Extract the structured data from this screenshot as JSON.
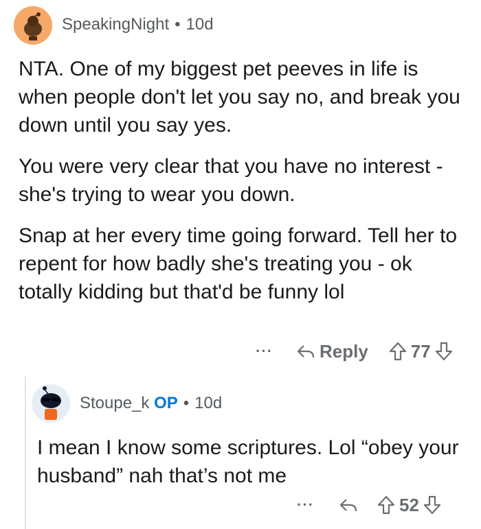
{
  "comments": [
    {
      "author": "SpeakingNight",
      "op_badge": "",
      "age": "10d",
      "paragraphs": [
        "NTA. One of my biggest pet peeves in life is when people don't let you say no, and break you down until you say yes.",
        "You were very clear that you have no interest - she's trying to wear you down.",
        "Snap at her every time going forward. Tell her to repent for how badly she's treating you - ok totally kidding but that'd be funny lol"
      ],
      "more_label": "···",
      "reply_label": "Reply",
      "vote_count": "77",
      "icons": {
        "reply": "reply-arrow-icon",
        "upvote": "upvote-arrow-icon",
        "downvote": "downvote-arrow-icon"
      }
    },
    {
      "author": "Stoupe_k",
      "op_badge": "OP",
      "age": "10d",
      "paragraphs": [
        "I mean I know some scriptures. Lol “obey your husband” nah that’s not me"
      ],
      "more_label": "···",
      "reply_label": "",
      "vote_count": "52",
      "icons": {
        "reply": "reply-arrow-icon",
        "upvote": "upvote-arrow-icon",
        "downvote": "downvote-arrow-icon"
      }
    }
  ],
  "colors": {
    "text": "#1a1a1b",
    "meta": "#555a5e",
    "op_badge": "#0079d3",
    "avatar1_bg": "#f5a868",
    "avatar2_bg": "#e6eef5",
    "thread_line": "#e2e4e6"
  },
  "separator": "•"
}
